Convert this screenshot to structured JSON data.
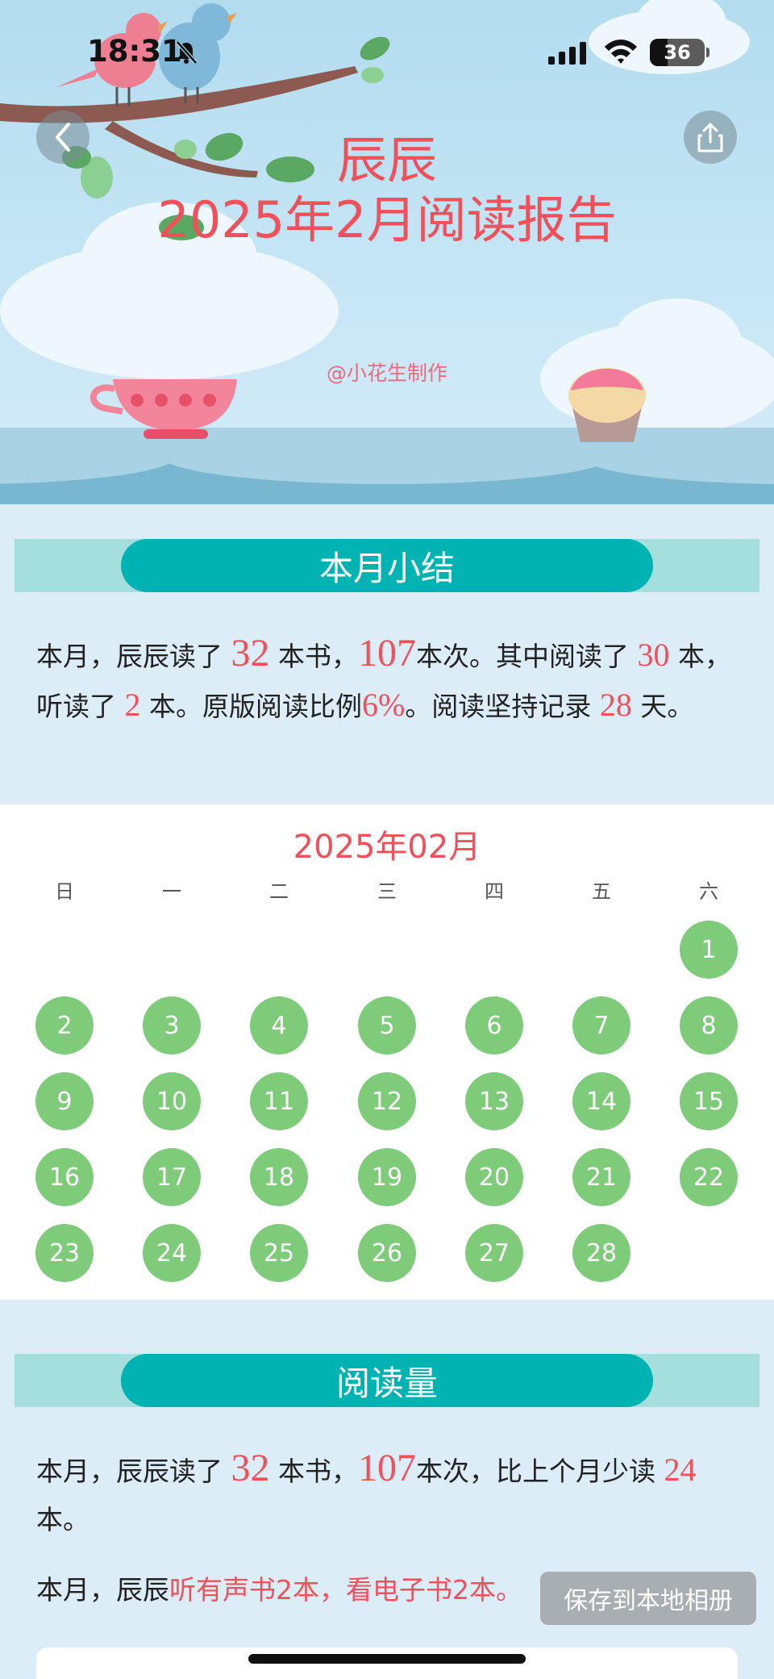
{
  "status_bar": {
    "time": "18:31",
    "battery": "36"
  },
  "header": {
    "name": "辰辰",
    "title": "2025年2月阅读报告",
    "maker": "@小花生制作"
  },
  "summary": {
    "heading": "本月小结",
    "p1": "本月，辰辰读了 ",
    "books": "32",
    "p2": " 本书，",
    "times": "107",
    "p3": "本次。其中阅读了 ",
    "read": "30",
    "p4": " 本，听读了 ",
    "listened": "2",
    "p5": " 本。原版阅读比例",
    "ratio": "6%",
    "p6": "。阅读坚持记录 ",
    "streak": "28",
    "p7": " 天。"
  },
  "calendar": {
    "title": "2025年02月",
    "weekdays": [
      "日",
      "一",
      "二",
      "三",
      "四",
      "五",
      "六"
    ],
    "days": [
      "1",
      "2",
      "3",
      "4",
      "5",
      "6",
      "7",
      "8",
      "9",
      "10",
      "11",
      "12",
      "13",
      "14",
      "15",
      "16",
      "17",
      "18",
      "19",
      "20",
      "21",
      "22",
      "23",
      "24",
      "25",
      "26",
      "27",
      "28"
    ]
  },
  "volume": {
    "heading": "阅读量",
    "p1": "本月，辰辰读了 ",
    "books": "32",
    "p2": " 本书，",
    "times": "107",
    "p3": "本次，比上个月少读 ",
    "less": "24",
    "p4": " 本。",
    "line2_prefix": "本月，辰辰",
    "line2_highlight": "听有声书2本，看电子书2本。"
  },
  "save_button": "保存到本地相册",
  "colors": {
    "accent": "#f0505a",
    "teal": "#00b3b3",
    "calendar_day": "#7ecb7a"
  }
}
